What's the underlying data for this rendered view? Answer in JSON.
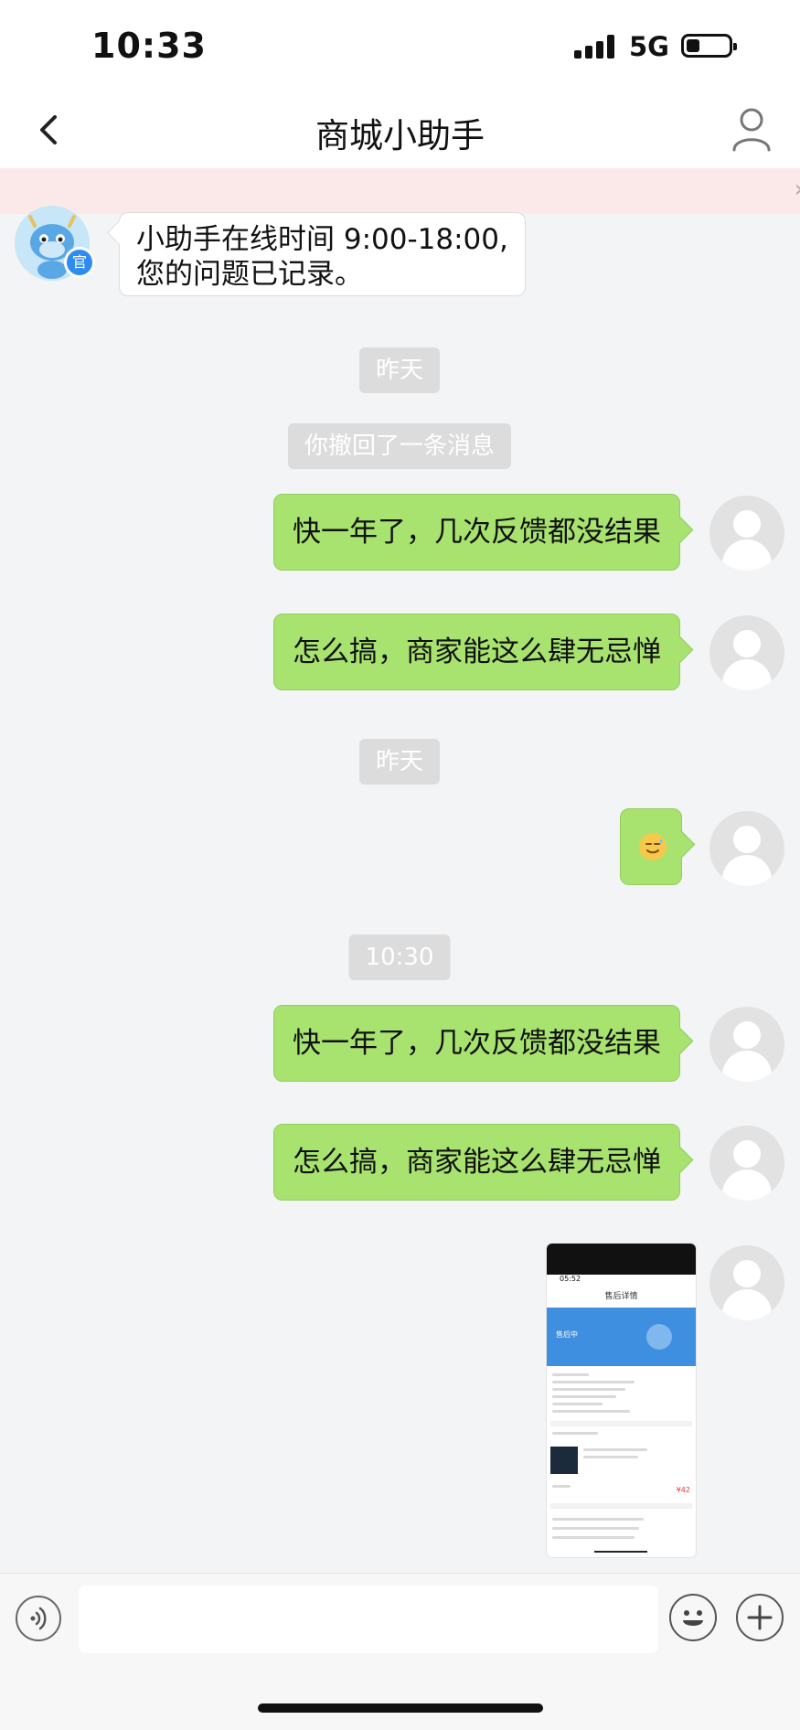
{
  "status": {
    "time": "10:33",
    "network": "5G"
  },
  "header": {
    "title": "商城小助手"
  },
  "messages": {
    "bot": {
      "line1": "小助手在线时间 9:00-18:00,",
      "line2": "您的问题已记录。",
      "badge": "官"
    },
    "divider1": "昨天",
    "recall": "你撤回了一条消息",
    "msg1": "快一年了，几次反馈都没结果",
    "msg2": "怎么搞，商家能这么肆无忌惮",
    "divider2": "昨天",
    "divider3": "10:30",
    "msg3": "快一年了，几次反馈都没结果",
    "msg4": "怎么搞，商家能这么肆无忌惮"
  },
  "screenshot_preview": {
    "time": "05:52",
    "title": "售后详情",
    "status": "售后中",
    "price": "¥42"
  },
  "input": {
    "placeholder": ""
  },
  "colors": {
    "bubble_out": "#a8e36f",
    "chat_bg": "#f3f4f6",
    "notice": "#fbe9ea",
    "chip": "#dcdcdc"
  },
  "icons": [
    "back-icon",
    "profile-icon",
    "voice-icon",
    "emoji-icon",
    "plus-icon",
    "signal-icon",
    "battery-icon"
  ]
}
